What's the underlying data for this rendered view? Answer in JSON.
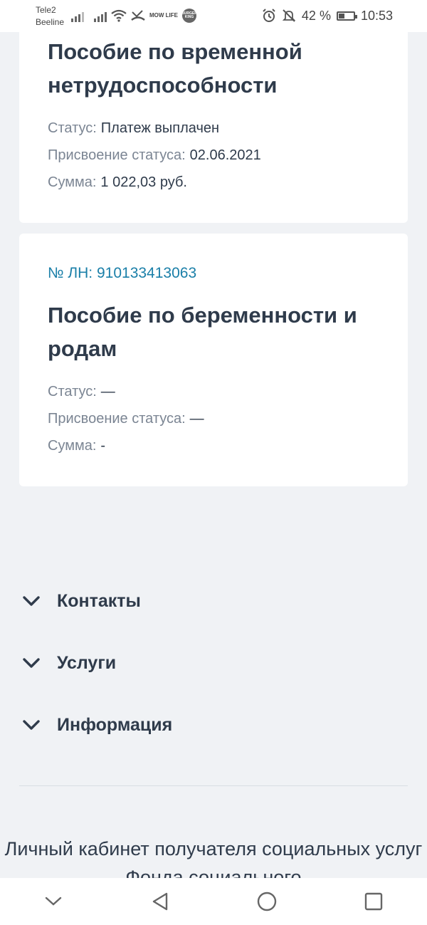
{
  "status_bar": {
    "carrier_1": "Tele2",
    "carrier_2": "Beeline",
    "logo_1": "MOW LIFE",
    "logo_2": "BURGER KING",
    "battery": "42 %",
    "battery_level": 0.42,
    "time": "10:53",
    "icons": [
      "signal-icon",
      "signal-icon",
      "wifi-icon",
      "missed-call-icon",
      "alarm-icon",
      "mute-icon",
      "battery-icon"
    ]
  },
  "cards": [
    {
      "title": "Пособие по временной нетрудоспособности",
      "status_label": "Статус:",
      "status_value": "Платеж выплачен",
      "assign_label": "Присвоение статуса:",
      "assign_value": "02.06.2021",
      "sum_label": "Сумма:",
      "sum_value": "1 022,03 руб."
    },
    {
      "ln": "№ ЛН: 910133413063",
      "title": "Пособие по беременности и родам",
      "status_label": "Статус:",
      "status_value": "—",
      "assign_label": "Присвоение статуса:",
      "assign_value": "—",
      "sum_label": "Сумма:",
      "sum_value": "-"
    }
  ],
  "accordion": [
    {
      "label": "Контакты"
    },
    {
      "label": "Услуги"
    },
    {
      "label": "Информация"
    }
  ],
  "footer": {
    "text": "Личный кабинет получателя социальных услуг Фонда социального"
  },
  "colors": {
    "accent": "#1a7fa8",
    "text": "#2f3b4b",
    "muted": "#7b8593",
    "background": "#f0f2f5"
  }
}
